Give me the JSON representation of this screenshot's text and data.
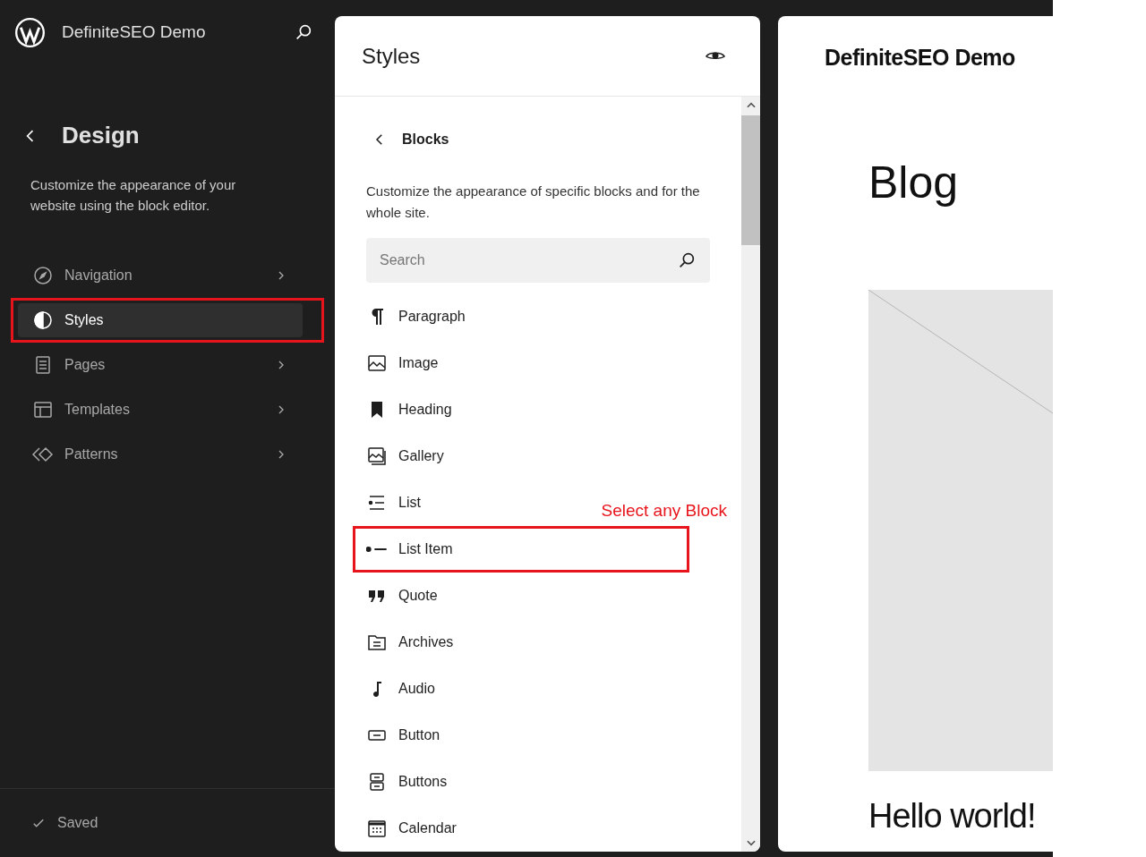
{
  "sidebar": {
    "site_title": "DefiniteSEO Demo",
    "heading": "Design",
    "description": "Customize the appearance of your website using the block editor.",
    "items": [
      {
        "label": "Navigation",
        "selected": false,
        "annotated": false
      },
      {
        "label": "Styles",
        "selected": true,
        "annotated": true
      },
      {
        "label": "Pages",
        "selected": false,
        "annotated": false
      },
      {
        "label": "Templates",
        "selected": false,
        "annotated": false
      },
      {
        "label": "Patterns",
        "selected": false,
        "annotated": false
      }
    ],
    "status": "Saved"
  },
  "styles_panel": {
    "title": "Styles",
    "section": "Blocks",
    "description": "Customize the appearance of specific blocks and for the whole site.",
    "search": {
      "placeholder": "Search"
    },
    "blocks": [
      {
        "label": "Paragraph",
        "annotated": false
      },
      {
        "label": "Image",
        "annotated": false
      },
      {
        "label": "Heading",
        "annotated": false
      },
      {
        "label": "Gallery",
        "annotated": false
      },
      {
        "label": "List",
        "annotated": false
      },
      {
        "label": "List Item",
        "annotated": true
      },
      {
        "label": "Quote",
        "annotated": false
      },
      {
        "label": "Archives",
        "annotated": false
      },
      {
        "label": "Audio",
        "annotated": false
      },
      {
        "label": "Button",
        "annotated": false
      },
      {
        "label": "Buttons",
        "annotated": false
      },
      {
        "label": "Calendar",
        "annotated": false
      }
    ],
    "annotation": "Select any Block"
  },
  "preview": {
    "site_title": "DefiniteSEO Demo",
    "page_title": "Blog",
    "post_title": "Hello world!"
  }
}
